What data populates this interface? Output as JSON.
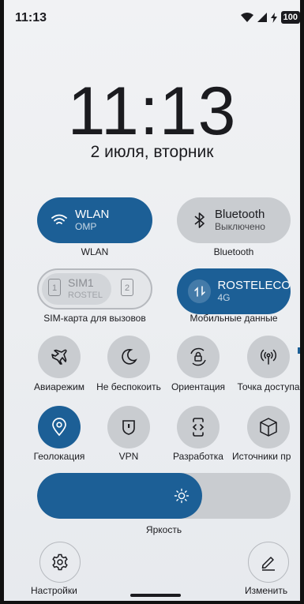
{
  "status_bar": {
    "time": "11:13",
    "battery": "100"
  },
  "lock": {
    "clock": "11:13",
    "date": "2 июля, вторник"
  },
  "tiles": {
    "wlan": {
      "title": "WLAN",
      "subtitle": "OMP",
      "label": "WLAN"
    },
    "bluetooth": {
      "title": "Bluetooth",
      "subtitle": "Выключено",
      "label": "Bluetooth"
    },
    "sim": {
      "title": "SIM1",
      "subtitle": "ROSTEL",
      "sim1_num": "1",
      "sim2_num": "2",
      "label": "SIM-карта для вызовов"
    },
    "mobile_data": {
      "title": "ROSTELECO",
      "subtitle": "4G",
      "label": "Мобильные данные"
    }
  },
  "toggles": {
    "airplane": "Авиарежим",
    "dnd": "Не беспокоить",
    "orientation": "Ориентация",
    "hotspot": "Точка доступа",
    "location": "Геолокация",
    "vpn": "VPN",
    "developer": "Разработка",
    "sources": "Источники пр"
  },
  "brightness": {
    "label": "Яркость",
    "level": 0.65
  },
  "bottom": {
    "settings": "Настройки",
    "edit": "Изменить"
  },
  "colors": {
    "accent": "#1c5f96",
    "tile_off": "#c9ccd0"
  }
}
